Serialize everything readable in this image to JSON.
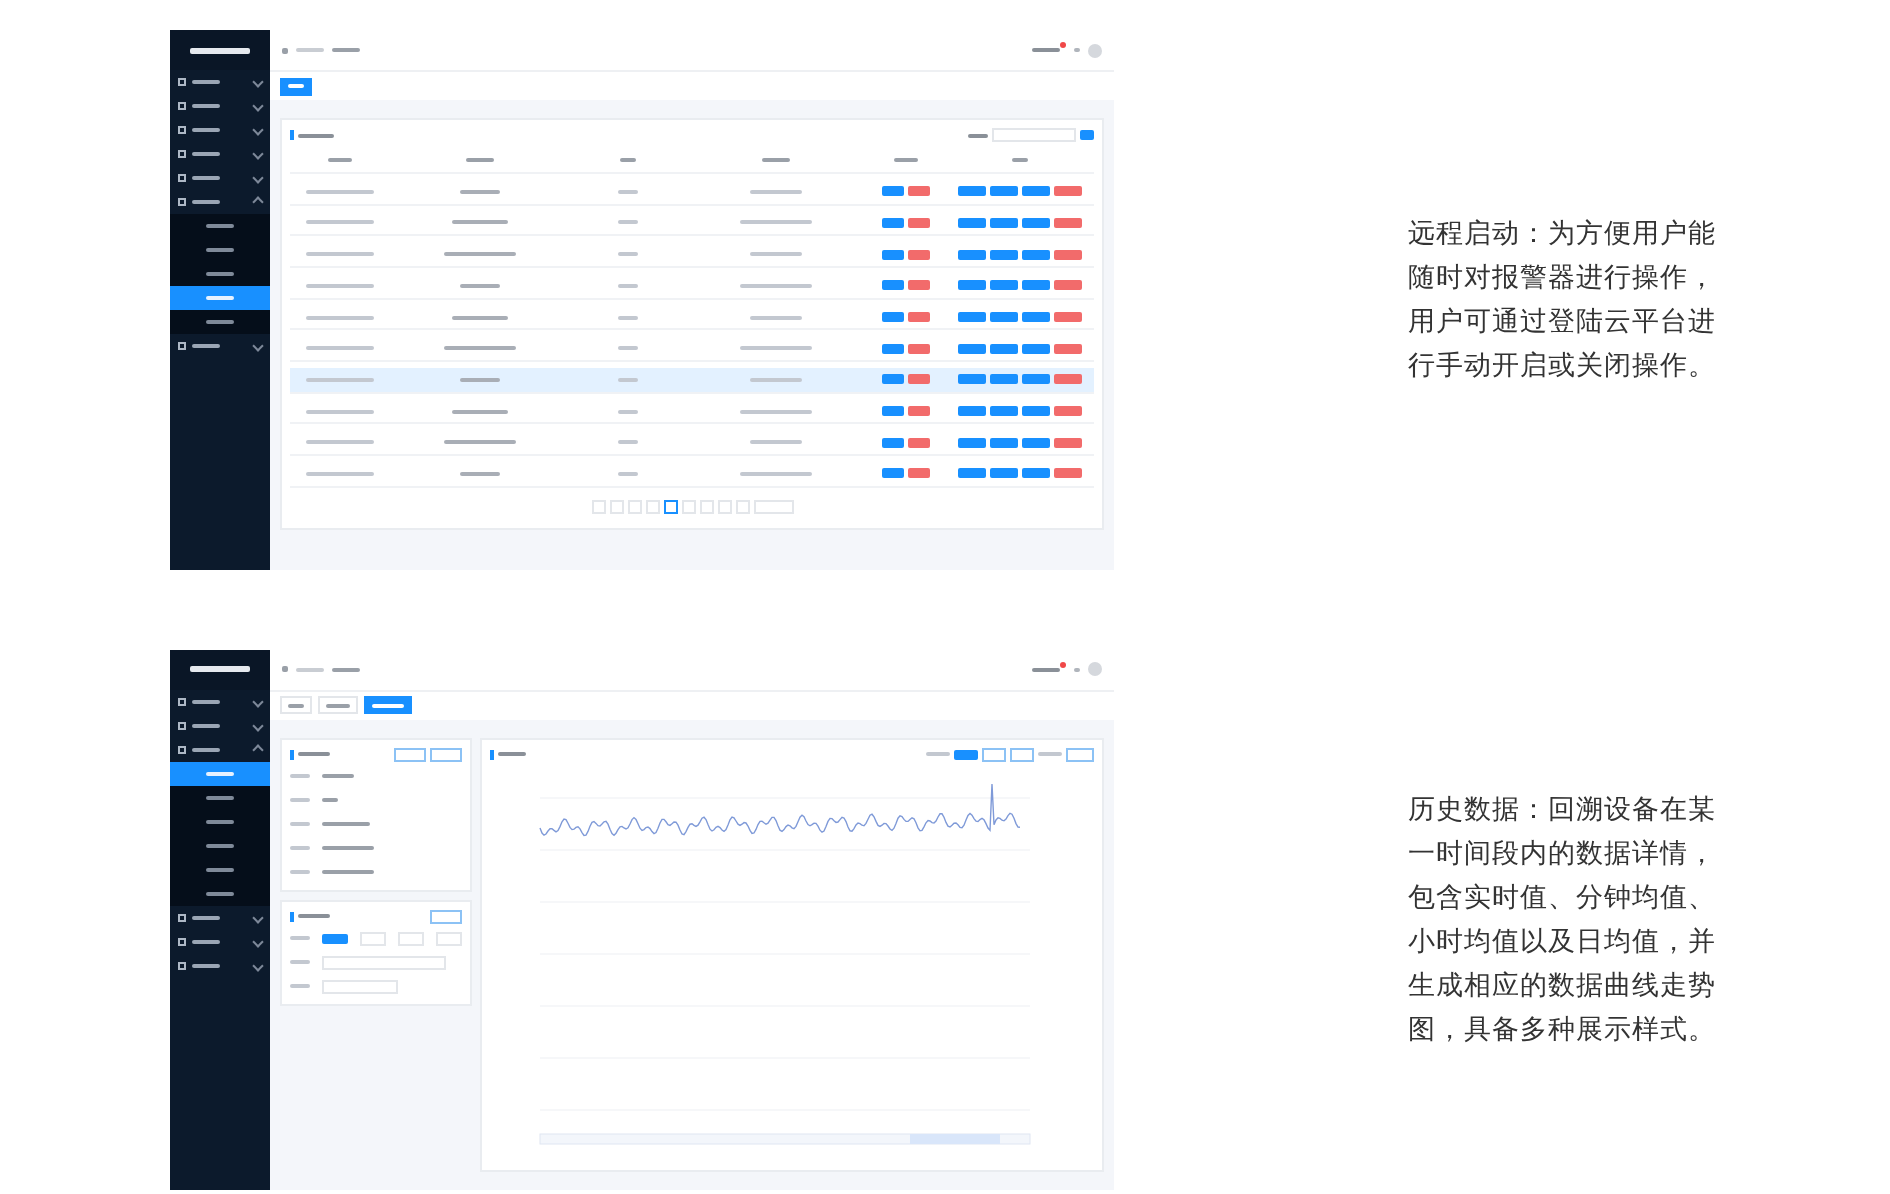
{
  "screens": [
    {
      "kind": "device-table",
      "tabs": [
        {
          "selected": true
        }
      ],
      "nav": [
        {
          "expanded": false
        },
        {
          "expanded": false
        },
        {
          "expanded": false
        },
        {
          "expanded": false
        },
        {
          "expanded": false
        },
        {
          "expanded": true,
          "children": [
            {
              "selected": false
            },
            {
              "selected": false
            },
            {
              "selected": false
            },
            {
              "selected": true
            },
            {
              "selected": false
            }
          ]
        },
        {
          "expanded": false
        }
      ],
      "rows": [
        {
          "selected": false
        },
        {
          "selected": false
        },
        {
          "selected": false
        },
        {
          "selected": false
        },
        {
          "selected": false
        },
        {
          "selected": false
        },
        {
          "selected": true
        },
        {
          "selected": false
        },
        {
          "selected": false
        },
        {
          "selected": false
        }
      ]
    },
    {
      "kind": "history-chart",
      "tabs": [
        {
          "selected": false
        },
        {
          "selected": false
        },
        {
          "selected": true
        }
      ],
      "nav": [
        {
          "expanded": false
        },
        {
          "expanded": false
        },
        {
          "expanded": true,
          "children": [
            {
              "selected": true
            },
            {
              "selected": false
            },
            {
              "selected": false
            },
            {
              "selected": false
            },
            {
              "selected": false
            },
            {
              "selected": false
            }
          ]
        },
        {
          "expanded": false
        },
        {
          "expanded": false
        },
        {
          "expanded": false
        }
      ]
    }
  ],
  "descriptions": [
    "远程启动：为方便用户能随时对报警器进行操作，用户可通过登陆云平台进行手动开启或关闭操作。",
    "历史数据：回溯设备在某一时间段内的数据详情，包含实时值、分钟均值、小时均值以及日均值，并生成相应的数据曲线走势图，具备多种展示样式。"
  ]
}
